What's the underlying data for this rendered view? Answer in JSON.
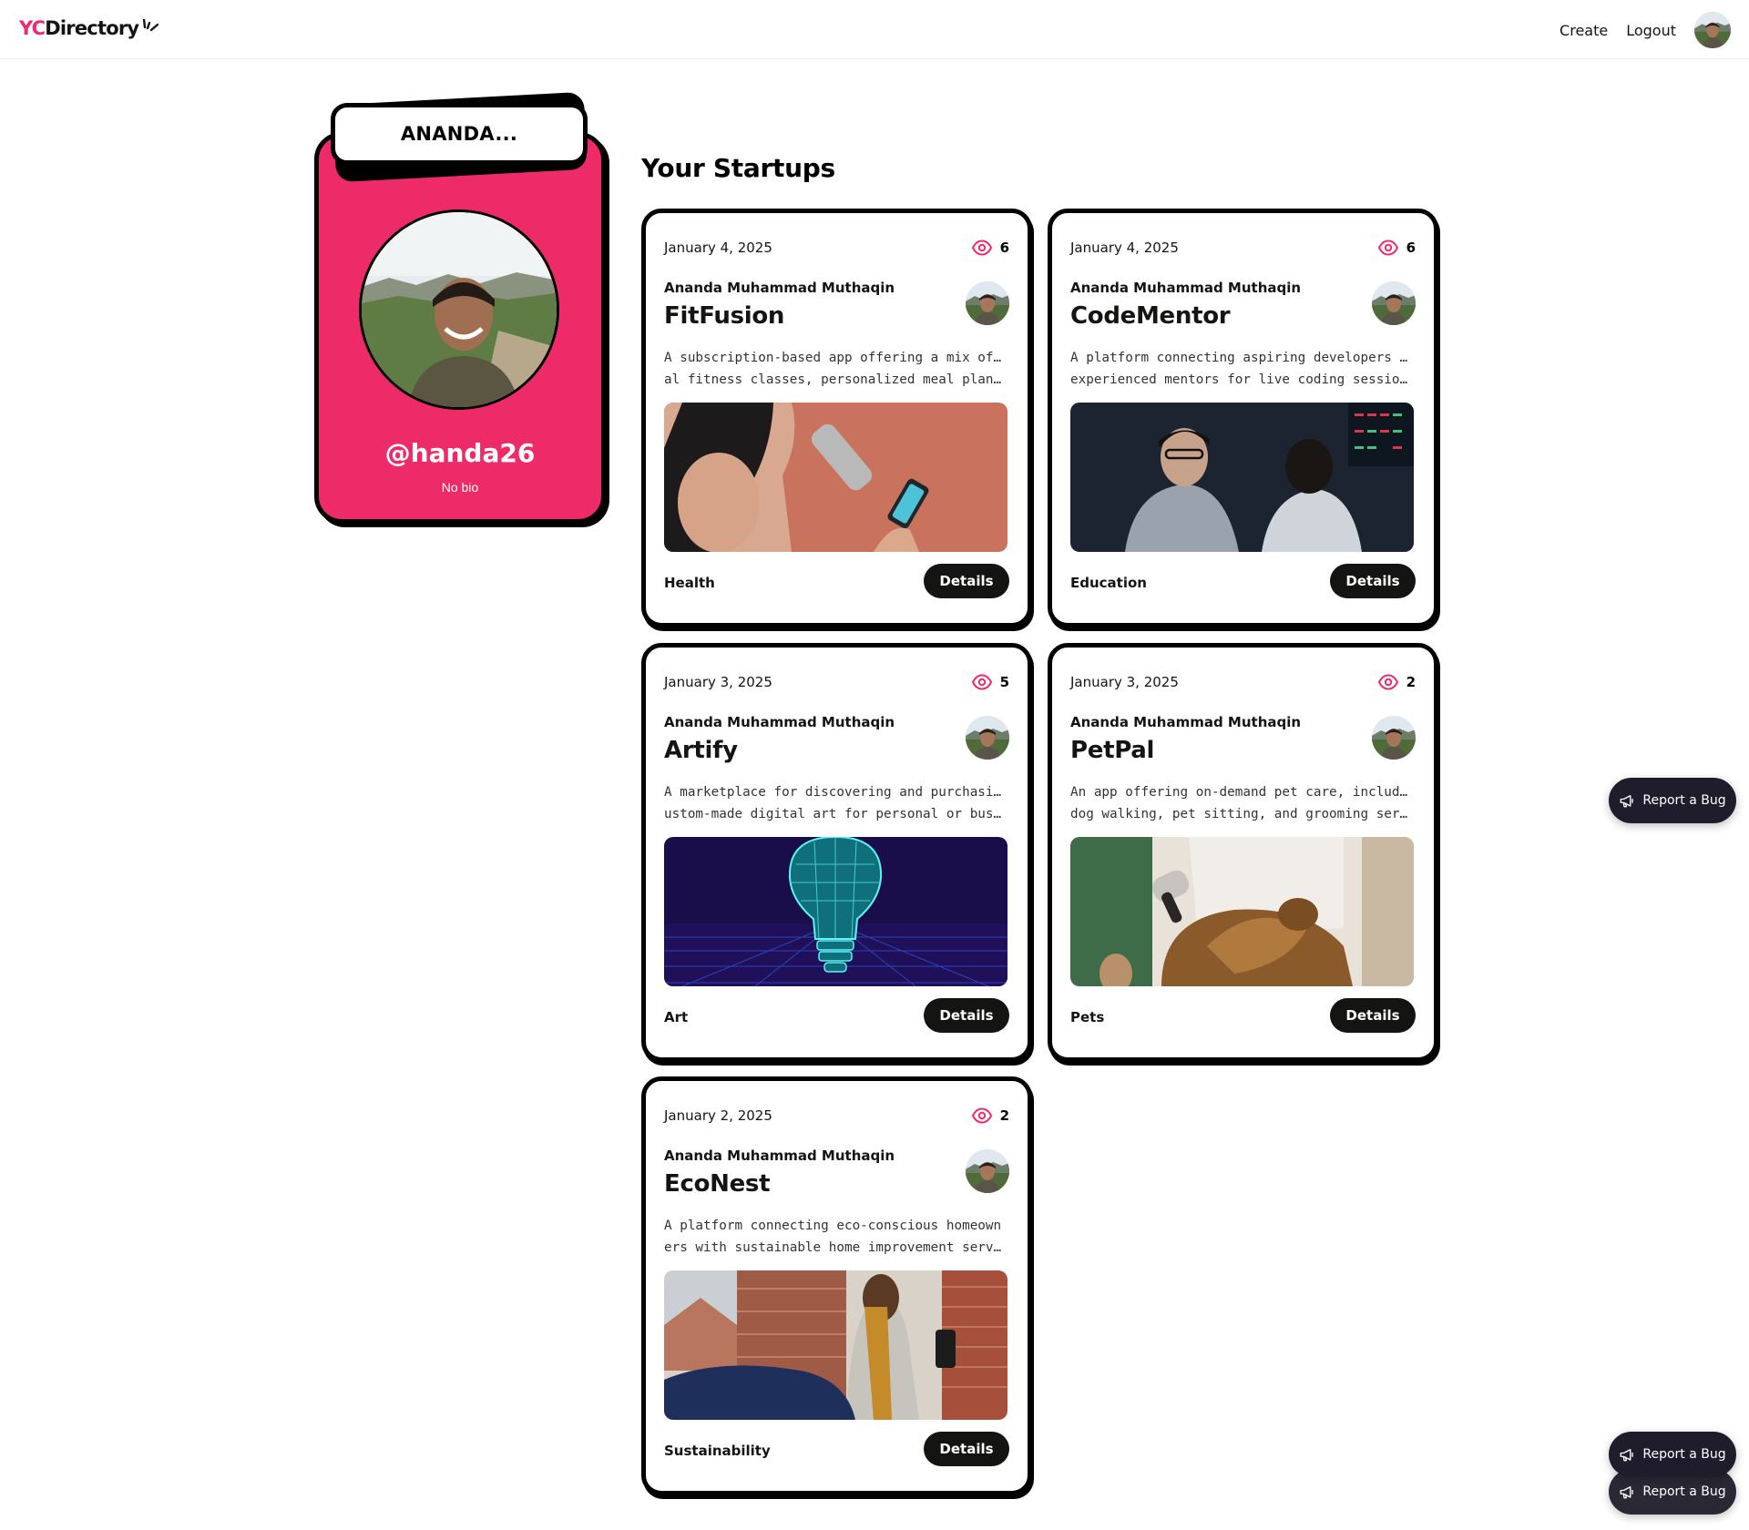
{
  "navbar": {
    "logo_yc": "YC",
    "logo_rest": "Directory",
    "links": [
      "Create",
      "Logout"
    ]
  },
  "profile": {
    "name": "ANANDA...",
    "handle": "@handa26",
    "bio": "No bio"
  },
  "section_title": "Your Startups",
  "startups": [
    {
      "date": "January 4, 2025",
      "views": "6",
      "author": "Ananda Muhammad Muthaqin",
      "title": "FitFusion",
      "desc1": "A subscription-based app offering a mix of virtu",
      "desc2": "al fitness classes, personalized meal plans, a...",
      "category": "Health",
      "button": "Details"
    },
    {
      "date": "January 4, 2025",
      "views": "6",
      "author": "Ananda Muhammad Muthaqin",
      "title": "CodeMentor",
      "desc1": "A platform connecting aspiring developers with",
      "desc2": "experienced mentors for live coding sessions ...",
      "category": "Education",
      "button": "Details"
    },
    {
      "date": "January 3, 2025",
      "views": "5",
      "author": "Ananda Muhammad Muthaqin",
      "title": "Artify",
      "desc1": "A marketplace for discovering and purchasing c",
      "desc2": "ustom-made digital art for personal or busine...",
      "category": "Art",
      "button": "Details"
    },
    {
      "date": "January 3, 2025",
      "views": "2",
      "author": "Ananda Muhammad Muthaqin",
      "title": "PetPal",
      "desc1": "An app offering on-demand pet care, including",
      "desc2": "dog walking, pet sitting, and grooming services.",
      "category": "Pets",
      "button": "Details"
    },
    {
      "date": "January 2, 2025",
      "views": "2",
      "author": "Ananda Muhammad Muthaqin",
      "title": "EcoNest",
      "desc1": "A platform connecting eco-conscious homeown",
      "desc2": "ers with sustainable home improvement servi...",
      "category": "Sustainability",
      "button": "Details"
    }
  ],
  "report_bug": "Report a Bug",
  "colors": {
    "brand": "#EE2B69",
    "dark": "#141413",
    "button": "#1f1d2b"
  }
}
